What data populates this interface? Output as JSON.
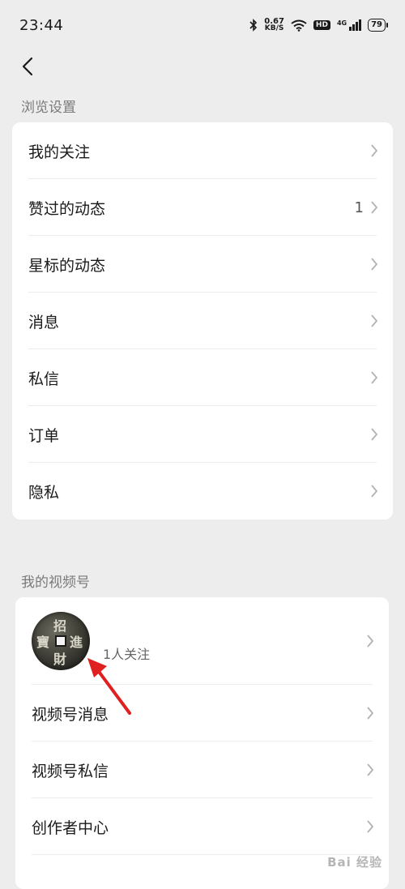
{
  "status_bar": {
    "time": "23:44",
    "speed_value": "0.67",
    "speed_unit": "KB/S",
    "hd_badge": "HD",
    "network": "4G",
    "battery": "79",
    "icons": [
      "bluetooth-icon",
      "wifi-icon",
      "signal-icon",
      "battery-icon"
    ]
  },
  "nav": {
    "back_icon": "chevron-left-icon"
  },
  "browse_section": {
    "title": "浏览设置",
    "items": [
      {
        "label": "我的关注",
        "value": ""
      },
      {
        "label": "赞过的动态",
        "value": "1"
      },
      {
        "label": "星标的动态",
        "value": ""
      },
      {
        "label": "消息",
        "value": ""
      },
      {
        "label": "私信",
        "value": ""
      },
      {
        "label": "订单",
        "value": ""
      },
      {
        "label": "隐私",
        "value": ""
      }
    ]
  },
  "channel_section": {
    "title": "我的视频号",
    "profile": {
      "follow_count": "1人关注",
      "avatar_chars": [
        "招",
        "進",
        "寶",
        "財"
      ]
    },
    "items": [
      {
        "label": "视频号消息"
      },
      {
        "label": "视频号私信"
      },
      {
        "label": "创作者中心"
      }
    ]
  },
  "watermark": "Bai 经验",
  "colors": {
    "background": "#ededed",
    "card": "#ffffff",
    "arrow": "#e02020"
  }
}
